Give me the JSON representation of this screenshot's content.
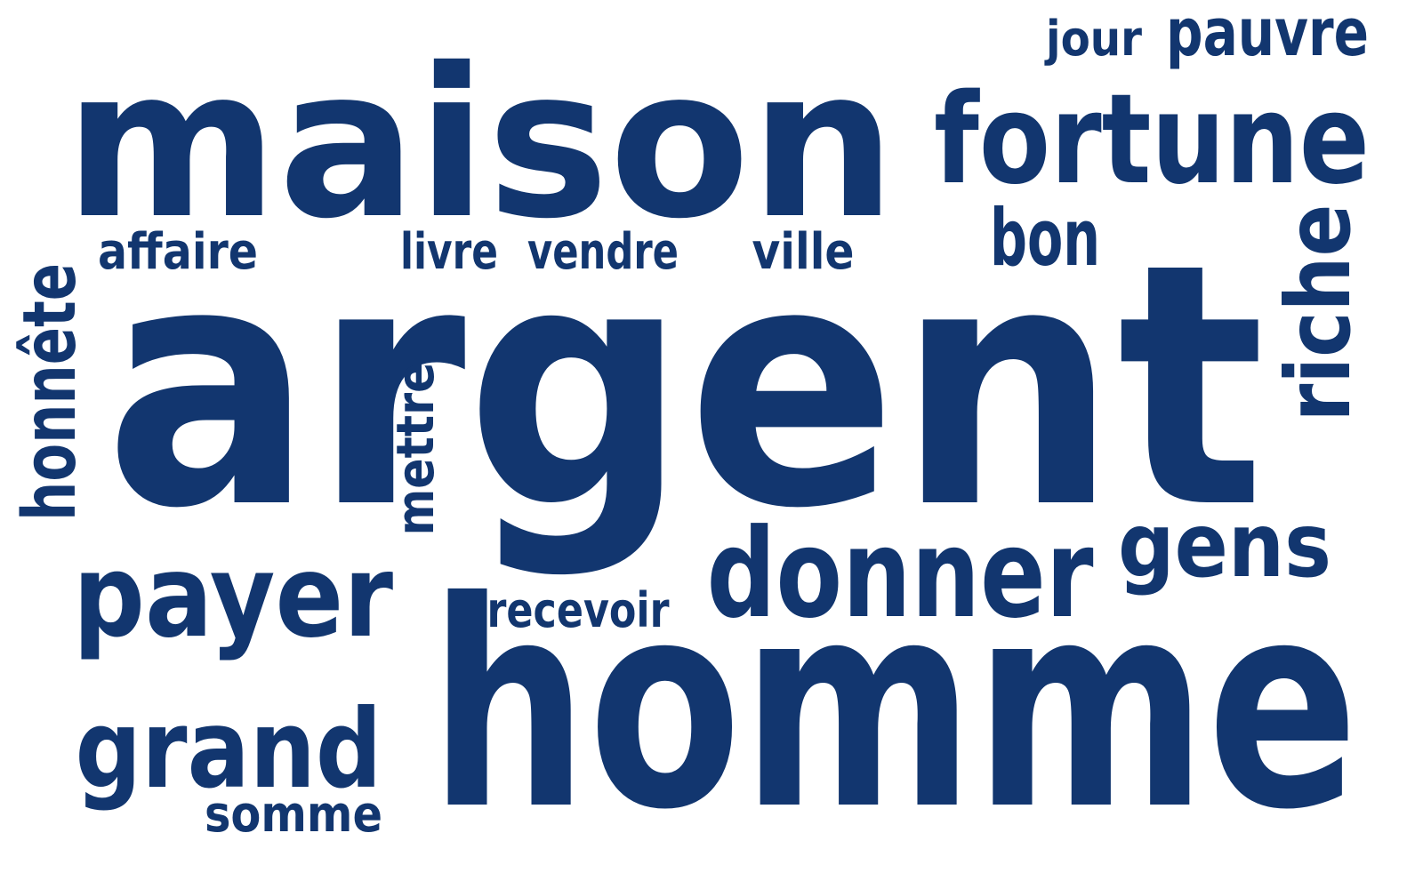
{
  "style": {
    "word_color": "#12366f",
    "background": "#ffffff"
  },
  "words": {
    "maison": "maison",
    "argent": "argent",
    "homme": "homme",
    "fortune": "fortune",
    "pauvre": "pauvre",
    "jour": "jour",
    "bon": "bon",
    "riche": "riche",
    "honnete": "honnête",
    "affaire": "affaire",
    "livre": "livre",
    "vendre": "vendre",
    "ville": "ville",
    "mettre": "mettre",
    "payer": "payer",
    "recevoir": "recevoir",
    "donner": "donner",
    "gens": "gens",
    "grand": "grand",
    "somme": "somme"
  }
}
